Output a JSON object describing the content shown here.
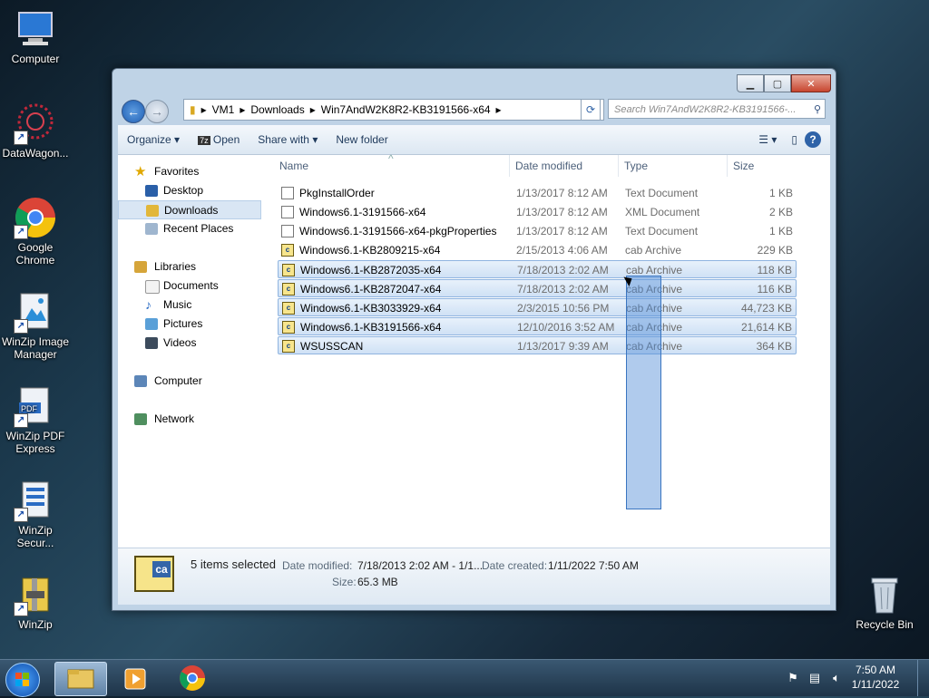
{
  "desktop": {
    "icons": [
      {
        "label": "Computer",
        "icon": "computer-icon"
      },
      {
        "label": "DataWagon...",
        "icon": "datawagon-icon"
      },
      {
        "label": "Google Chrome",
        "icon": "chrome-icon"
      },
      {
        "label": "WinZip Image Manager",
        "icon": "winzip-image-icon"
      },
      {
        "label": "WinZip PDF Express",
        "icon": "pdf-icon"
      },
      {
        "label": "WinZip Secur...",
        "icon": "winzip-secure-icon"
      },
      {
        "label": "WinZip",
        "icon": "winzip-icon"
      },
      {
        "label": "Recycle Bin",
        "icon": "recycle-bin-icon"
      }
    ]
  },
  "window": {
    "address": {
      "crumbs": [
        "VM1",
        "Downloads",
        "Win7AndW2K8R2-KB3191566-x64"
      ]
    },
    "search_placeholder": "Search Win7AndW2K8R2-KB3191566-...",
    "toolbar": {
      "organize": "Organize",
      "open": "Open",
      "share": "Share with",
      "new_folder": "New folder"
    },
    "nav": {
      "favorites": "Favorites",
      "desktop": "Desktop",
      "downloads": "Downloads",
      "recent": "Recent Places",
      "libraries": "Libraries",
      "documents": "Documents",
      "music": "Music",
      "pictures": "Pictures",
      "videos": "Videos",
      "computer": "Computer",
      "network": "Network"
    },
    "columns": {
      "name": "Name",
      "date": "Date modified",
      "type": "Type",
      "size": "Size"
    },
    "files": [
      {
        "name": "PkgInstallOrder",
        "date": "1/13/2017 8:12 AM",
        "type": "Text Document",
        "size": "1 KB",
        "kind": "doc",
        "selected": false
      },
      {
        "name": "Windows6.1-3191566-x64",
        "date": "1/13/2017 8:12 AM",
        "type": "XML Document",
        "size": "2 KB",
        "kind": "doc",
        "selected": false
      },
      {
        "name": "Windows6.1-3191566-x64-pkgProperties",
        "date": "1/13/2017 8:12 AM",
        "type": "Text Document",
        "size": "1 KB",
        "kind": "doc",
        "selected": false
      },
      {
        "name": "Windows6.1-KB2809215-x64",
        "date": "2/15/2013 4:06 AM",
        "type": "cab Archive",
        "size": "229 KB",
        "kind": "cab",
        "selected": false
      },
      {
        "name": "Windows6.1-KB2872035-x64",
        "date": "7/18/2013 2:02 AM",
        "type": "cab Archive",
        "size": "118 KB",
        "kind": "cab",
        "selected": true
      },
      {
        "name": "Windows6.1-KB2872047-x64",
        "date": "7/18/2013 2:02 AM",
        "type": "cab Archive",
        "size": "116 KB",
        "kind": "cab",
        "selected": true
      },
      {
        "name": "Windows6.1-KB3033929-x64",
        "date": "2/3/2015 10:56 PM",
        "type": "cab Archive",
        "size": "44,723 KB",
        "kind": "cab",
        "selected": true
      },
      {
        "name": "Windows6.1-KB3191566-x64",
        "date": "12/10/2016 3:52 AM",
        "type": "cab Archive",
        "size": "21,614 KB",
        "kind": "cab",
        "selected": true
      },
      {
        "name": "WSUSSCAN",
        "date": "1/13/2017 9:39 AM",
        "type": "cab Archive",
        "size": "364 KB",
        "kind": "cab",
        "selected": true
      }
    ],
    "details": {
      "count": "5 items selected",
      "modified_label": "Date modified:",
      "modified_value": "7/18/2013 2:02 AM - 1/1...",
      "created_label": "Date created:",
      "created_value": "1/11/2022 7:50 AM",
      "size_label": "Size:",
      "size_value": "65.3 MB",
      "icon_label": "ca"
    }
  },
  "taskbar": {
    "time": "7:50 AM",
    "date": "1/11/2022"
  }
}
